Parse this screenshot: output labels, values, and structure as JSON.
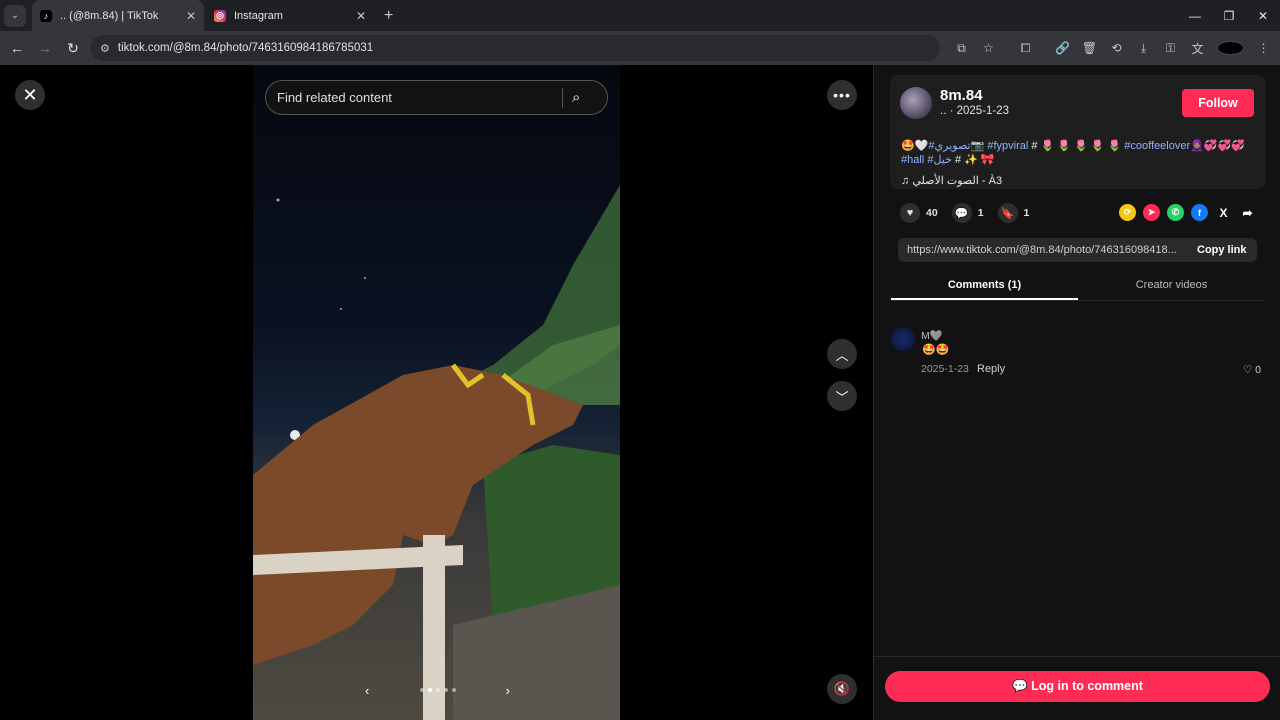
{
  "browser": {
    "tabs": [
      {
        "title": ".. (@8m.84) | TikTok",
        "favicon": "tiktok-icon",
        "active": true
      },
      {
        "title": "Instagram",
        "favicon": "instagram-icon",
        "active": false
      }
    ],
    "new_tab_icon": "+",
    "url": "tiktok.com/@8m.84/photo/7463160984186785031"
  },
  "viewer": {
    "search_placeholder": "Find related content",
    "close_icon": "✕",
    "more_icon": "•••",
    "up_icon": "︿",
    "down_icon": "﹀",
    "mute_icon": "🔇",
    "prev_icon": "‹",
    "next_icon": "›"
  },
  "post": {
    "username": "8m.84",
    "meta": ".. · 2025-1-23",
    "follow_label": "Follow",
    "caption_line1_start": "🤩🤍",
    "caption_tag1": "#تصويري",
    "caption_mid1": "📷",
    "caption_tag2": "#fyp",
    "caption_tag3": "viral",
    "caption_mid2": " # 🌷 🌷 🌷 🌷 🌷 ",
    "caption_tag4": "#cooffeelover",
    "caption_end1": "🧕🏽💞💞💞",
    "caption_tag5": "#hall",
    "caption_tag6": "#خيل",
    "caption_end2": " # ✨ 🎀",
    "music": "الصوت الأصلي - À3",
    "likes": "40",
    "comments_count": "1",
    "saves": "1",
    "share_link": "https://www.tiktok.com/@8m.84/photo/746316098418...",
    "copy_label": "Copy link",
    "tab_comments": "Comments (1)",
    "tab_creator": "Creator videos"
  },
  "comments": [
    {
      "name": "M🩶",
      "text": "🤩🤩",
      "date": "2025-1-23",
      "reply": "Reply",
      "likes": "0"
    }
  ],
  "login_label": "Log in to comment",
  "colors": {
    "accent": "#fe2c55",
    "tag": "#8fb3ff",
    "bg": "#121212"
  }
}
